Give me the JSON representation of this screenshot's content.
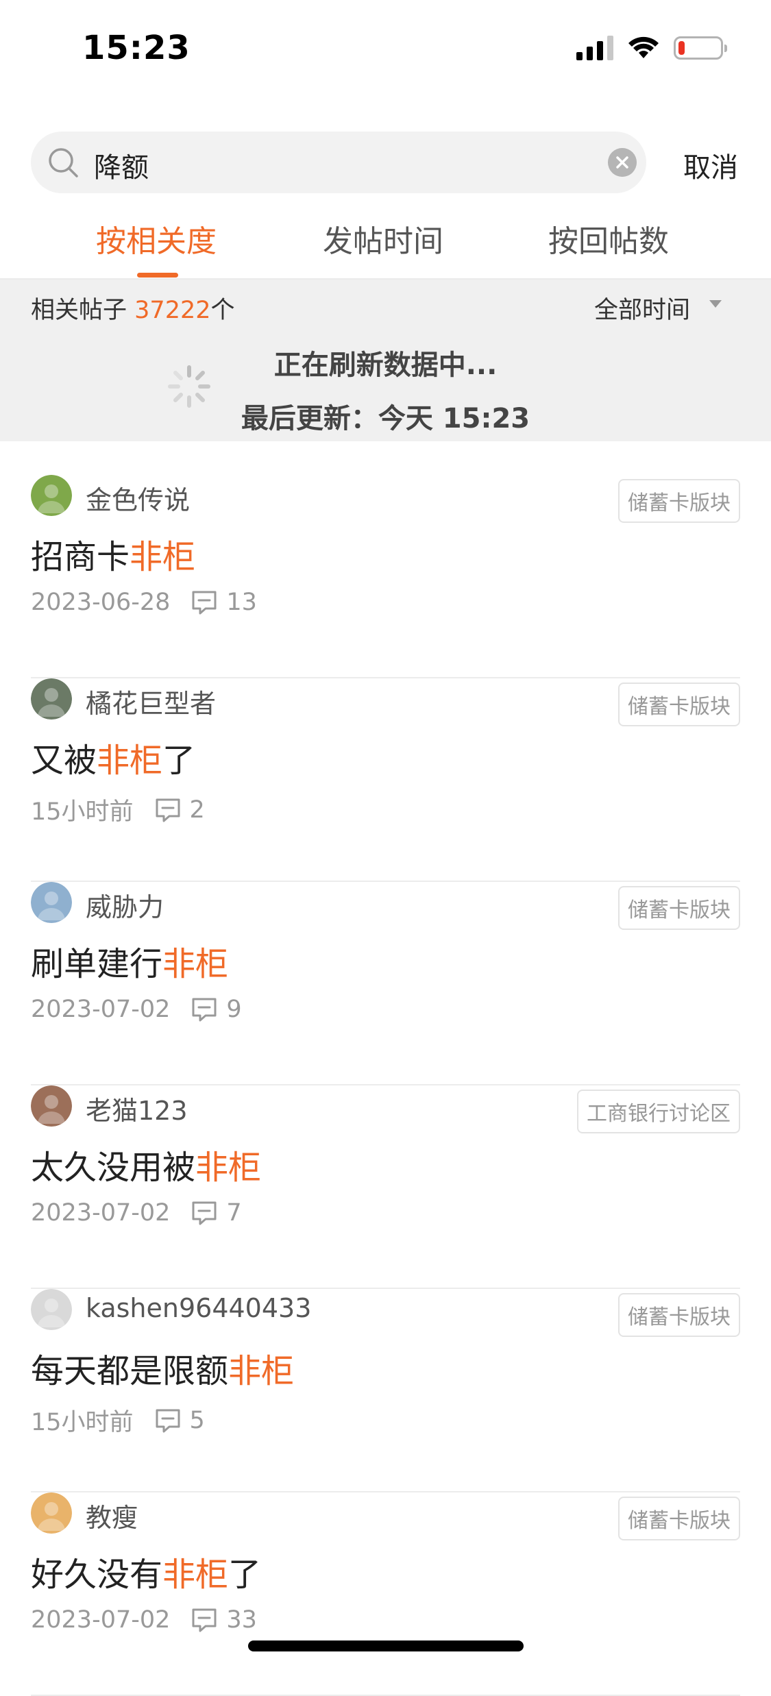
{
  "status_bar": {
    "time": "15:23",
    "signal_bars": 3,
    "battery_level": 0.15
  },
  "search": {
    "query": "降额",
    "cancel_label": "取消"
  },
  "tabs": [
    {
      "label": "按相关度",
      "active": true
    },
    {
      "label": "发帖时间",
      "active": false
    },
    {
      "label": "按回帖数",
      "active": false
    }
  ],
  "results": {
    "count_prefix": "相关帖子",
    "count": "37222",
    "count_suffix": "个",
    "time_filter": "全部时间",
    "refresh_text": "正在刷新数据中...",
    "last_update": "最后更新：今天 15:23"
  },
  "posts": [
    {
      "author": "金色传说",
      "board": "储蓄卡版块",
      "title_before": "招商卡",
      "title_highlight": "非柜",
      "title_after": "",
      "date": "2023-06-28",
      "comments": "13",
      "avatar_color": "#7fa84a"
    },
    {
      "author": "橘花巨型者",
      "board": "储蓄卡版块",
      "title_before": "又被",
      "title_highlight": "非柜",
      "title_after": "了",
      "date": "15小时前",
      "comments": "2",
      "avatar_color": "#6b7a66"
    },
    {
      "author": "威胁力",
      "board": "储蓄卡版块",
      "title_before": "刷单建行",
      "title_highlight": "非柜",
      "title_after": "",
      "date": "2023-07-02",
      "comments": "9",
      "avatar_color": "#8fb0cf"
    },
    {
      "author": "老猫123",
      "board": "工商银行讨论区",
      "title_before": "太久没用被",
      "title_highlight": "非柜",
      "title_after": "",
      "date": "2023-07-02",
      "comments": "7",
      "avatar_color": "#9c6f59"
    },
    {
      "author": "kashen96440433",
      "board": "储蓄卡版块",
      "title_before": "每天都是限额",
      "title_highlight": "非柜",
      "title_after": "",
      "date": "15小时前",
      "comments": "5",
      "avatar_color": "#d9d9d9"
    },
    {
      "author": "教瘦",
      "board": "储蓄卡版块",
      "title_before": "好久没有",
      "title_highlight": "非柜",
      "title_after": "了",
      "date": "2023-07-02",
      "comments": "33",
      "avatar_color": "#e9b36a"
    }
  ],
  "colors": {
    "accent": "#f06a28",
    "muted": "#999999"
  }
}
